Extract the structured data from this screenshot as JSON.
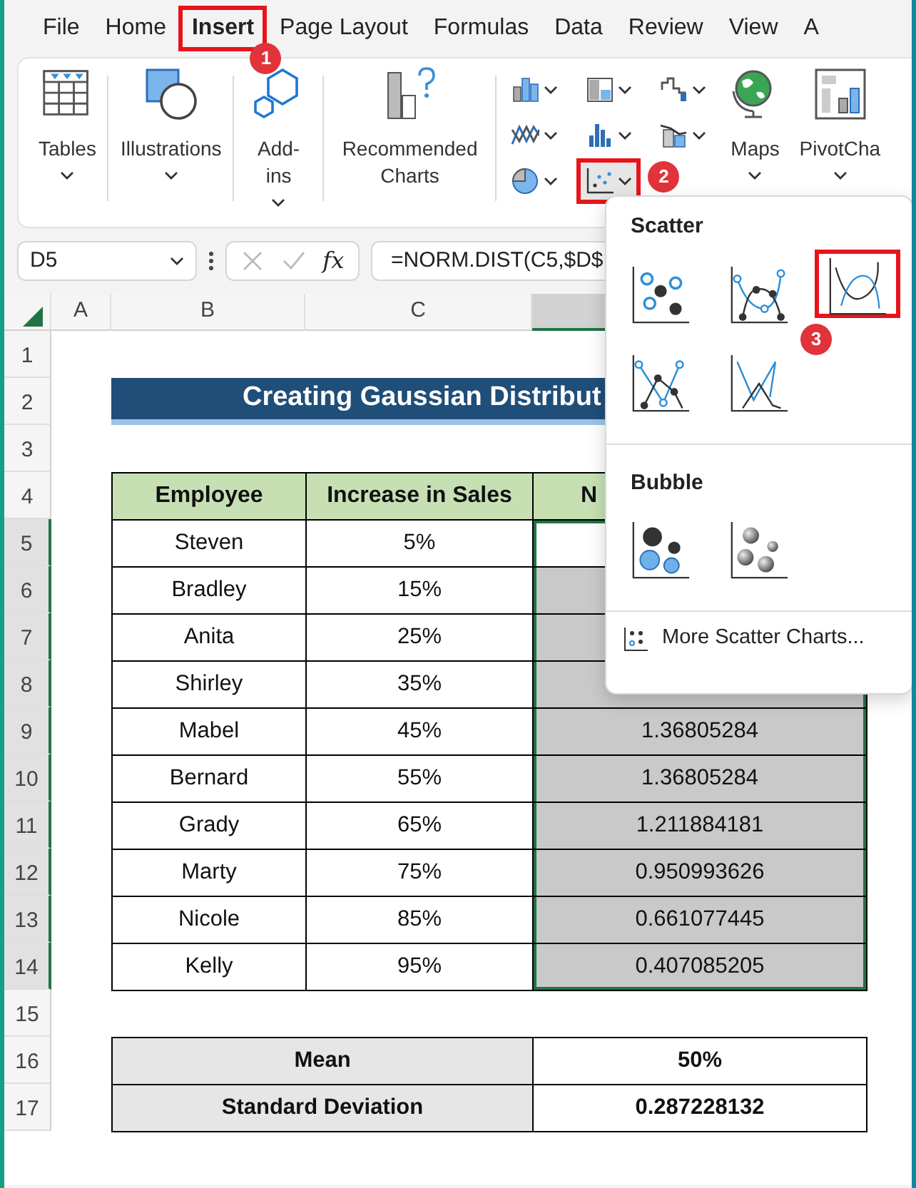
{
  "tabs": [
    {
      "label": "File",
      "selected": false
    },
    {
      "label": "Home",
      "selected": false
    },
    {
      "label": "Insert",
      "selected": true,
      "callout": "1"
    },
    {
      "label": "Page Layout",
      "selected": false
    },
    {
      "label": "Formulas",
      "selected": false
    },
    {
      "label": "Data",
      "selected": false
    },
    {
      "label": "Review",
      "selected": false
    },
    {
      "label": "View",
      "selected": false
    },
    {
      "label": "A",
      "selected": false
    }
  ],
  "ribbon": {
    "groups": [
      {
        "kind": "tables",
        "label": "Tables"
      },
      {
        "kind": "illustrations",
        "label": "Illustrations"
      },
      {
        "kind": "addins",
        "label": "Add-ins"
      },
      {
        "kind": "recommended",
        "label": "Recommended Charts"
      },
      {
        "kind": "charts"
      },
      {
        "kind": "maps",
        "label": "Maps"
      },
      {
        "kind": "pivot",
        "label": "PivotCha"
      }
    ],
    "chart_buttons": [
      {
        "kind": "column"
      },
      {
        "kind": "hierarchy"
      },
      {
        "kind": "waterfall"
      },
      {
        "kind": "line"
      },
      {
        "kind": "statistic"
      },
      {
        "kind": "combo"
      },
      {
        "kind": "pie"
      },
      {
        "kind": "scatter",
        "callout": "2"
      }
    ]
  },
  "formula_bar": {
    "name_box": "D5",
    "function_label": "fx",
    "formula": "=NORM.DIST(C5,$D$"
  },
  "sheet": {
    "columns": [
      {
        "label": "A",
        "selected": false
      },
      {
        "label": "B",
        "selected": false
      },
      {
        "label": "C",
        "selected": false
      },
      {
        "selected": true
      }
    ],
    "rows": [
      {
        "label": "1",
        "selected": false
      },
      {
        "label": "2",
        "selected": false
      },
      {
        "label": "3",
        "selected": false
      },
      {
        "label": "4",
        "selected": false
      },
      {
        "label": "5",
        "selected": true
      },
      {
        "label": "6",
        "selected": true
      },
      {
        "label": "7",
        "selected": true
      },
      {
        "label": "8",
        "selected": true
      },
      {
        "label": "9",
        "selected": true
      },
      {
        "label": "10",
        "selected": true
      },
      {
        "label": "11",
        "selected": true
      },
      {
        "label": "12",
        "selected": true
      },
      {
        "label": "13",
        "selected": true
      },
      {
        "label": "14",
        "selected": true
      },
      {
        "label": "15",
        "selected": false
      },
      {
        "label": "16",
        "selected": false
      },
      {
        "label": "17",
        "selected": false
      }
    ],
    "title": "Creating Gaussian Distribut",
    "table": {
      "columns": [
        "Employee",
        "Increase in Sales",
        "N"
      ],
      "rows": [
        {
          "employee": "Steven",
          "increase": "5%",
          "active": true
        },
        {
          "employee": "Bradley",
          "increase": "15%",
          "active": false
        },
        {
          "employee": "Anita",
          "increase": "25%",
          "active": false
        },
        {
          "employee": "Shirley",
          "increase": "35%",
          "active": false
        },
        {
          "employee": "Mabel",
          "increase": "45%",
          "active": false,
          "density": "1.36805284"
        },
        {
          "employee": "Bernard",
          "increase": "55%",
          "active": false,
          "density": "1.36805284"
        },
        {
          "employee": "Grady",
          "increase": "65%",
          "active": false,
          "density": "1.211884181"
        },
        {
          "employee": "Marty",
          "increase": "75%",
          "active": false,
          "density": "0.950993626"
        },
        {
          "employee": "Nicole",
          "increase": "85%",
          "active": false,
          "density": "0.661077445"
        },
        {
          "employee": "Kelly",
          "increase": "95%",
          "active": false,
          "density": "0.407085205"
        }
      ]
    },
    "summary": [
      {
        "label": "Mean",
        "value": "50%"
      },
      {
        "label": "Standard Deviation",
        "value": "0.287228132"
      }
    ]
  },
  "menu": {
    "sections": [
      {
        "title": "Scatter",
        "items": [
          {
            "kind": "markers",
            "selected": false
          },
          {
            "kind": "smooth-markers",
            "selected": false
          },
          {
            "kind": "smooth",
            "selected": true,
            "callout": "3"
          },
          {
            "kind": "straight-markers",
            "selected": false
          },
          {
            "kind": "straight",
            "selected": false
          }
        ]
      },
      {
        "title": "Bubble",
        "items": [
          {
            "kind": "bubble",
            "selected": false
          },
          {
            "kind": "bubble-3d",
            "selected": false
          }
        ]
      }
    ],
    "footer": "More Scatter Charts..."
  }
}
